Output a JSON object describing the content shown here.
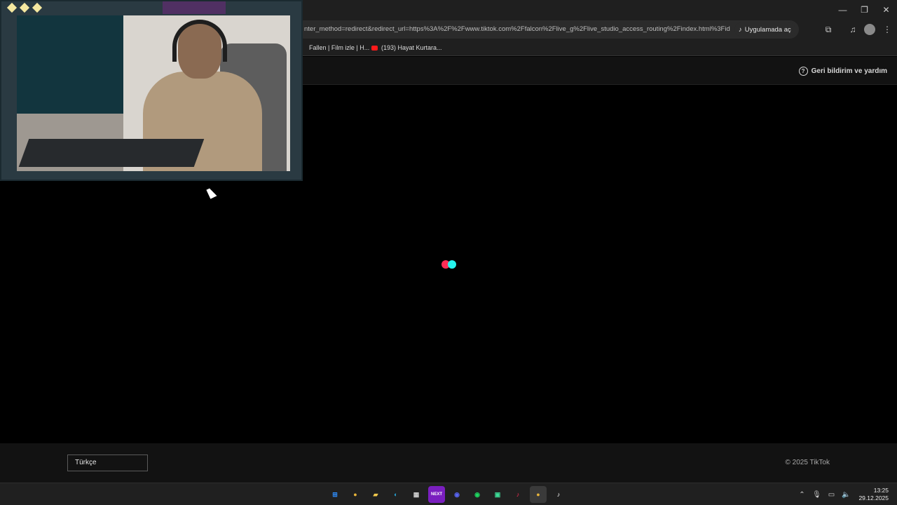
{
  "browser": {
    "url": "nter_method=redirect&redirect_url=https%3A%2F%2Fwww.tiktok.com%2Ffalcon%2Flive_g%2Flive_studio_access_routing%2Findex.html%3Fid%3...",
    "open_in_app_label": "Uygulamada aç",
    "bookmarks": [
      {
        "label": "Fallen | Film izle | H..."
      },
      {
        "label": "(193) Hayat Kurtara..."
      }
    ]
  },
  "page": {
    "help_label": "Geri bildirim ve yardım",
    "language": "Türkçe",
    "copyright": "© 2025 TikTok",
    "loader_colors": {
      "red": "#fe2c55",
      "cyan": "#25f4ee"
    }
  },
  "taskbar": {
    "apps": [
      {
        "name": "windows-start",
        "glyph": "⊞",
        "color": "#2f8fff"
      },
      {
        "name": "chrome",
        "glyph": "●",
        "color": "#e8b43a"
      },
      {
        "name": "file-explorer",
        "glyph": "▰",
        "color": "#f2c94c"
      },
      {
        "name": "edge",
        "glyph": "◐",
        "color": "#25a5d8"
      },
      {
        "name": "store",
        "glyph": "▦",
        "color": "#cfcfcf"
      },
      {
        "name": "next",
        "glyph": "NEXT",
        "color": "#7a1fbf"
      },
      {
        "name": "discord",
        "glyph": "◉",
        "color": "#5865f2"
      },
      {
        "name": "spotify",
        "glyph": "◉",
        "color": "#1ed760"
      },
      {
        "name": "app-green",
        "glyph": "▣",
        "color": "#3ddc97"
      },
      {
        "name": "tiktok-live",
        "glyph": "♪",
        "color": "#fe2c55"
      },
      {
        "name": "chrome-active",
        "glyph": "●",
        "color": "#e8b43a"
      },
      {
        "name": "tiktok",
        "glyph": "♪",
        "color": "#ffffff"
      }
    ],
    "time": "13:25",
    "date": "29.12.2025"
  }
}
